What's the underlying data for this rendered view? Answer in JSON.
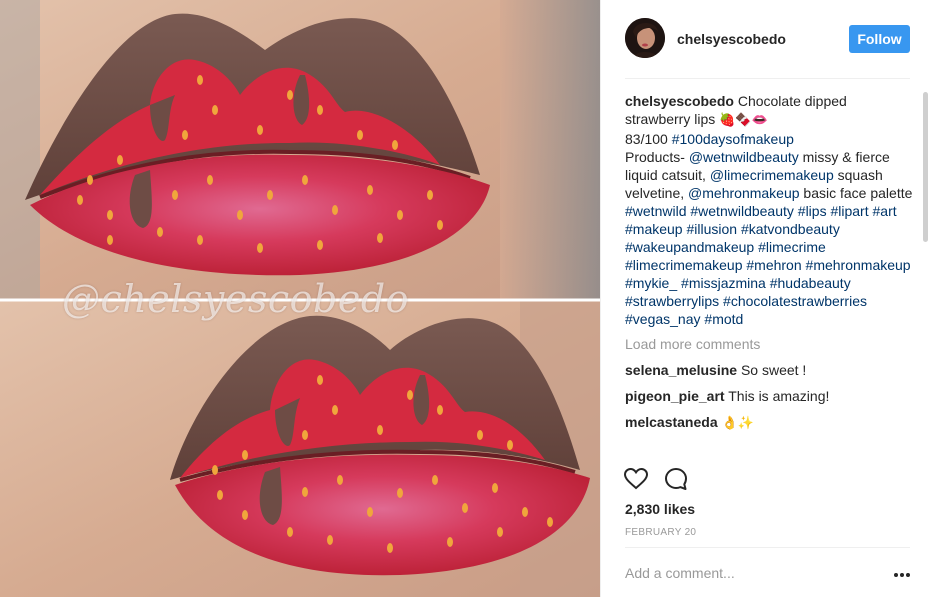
{
  "photo": {
    "watermark": "@chelsyescobedo"
  },
  "header": {
    "username": "chelsyescobedo",
    "follow_label": "Follow"
  },
  "caption": {
    "username": "chelsyescobedo",
    "text1": " Chocolate dipped strawberry lips ",
    "emoji1": "🍓🍫👄",
    "line2_prefix": "83/100 ",
    "hashtag_100days": "#100daysofmakeup",
    "products_prefix": "Products- ",
    "mention1": "@wetnwildbeauty",
    "products_mid1": " missy & fierce liquid catsuit, ",
    "mention2": "@limecrimemakeup",
    "products_mid2": " squash velvetine, ",
    "mention3": "@mehronmakeup",
    "products_end": " basic face palette",
    "hashtags": [
      "#wetnwild",
      "#wetnwildbeauty",
      "#lips",
      "#lipart",
      "#art",
      "#makeup",
      "#illusion",
      "#katvondbeauty",
      "#wakeupandmakeup",
      "#limecrime",
      "#limecrimemakeup",
      "#mehron",
      "#mehronmakeup",
      "#mykie_",
      "#missjazmina",
      "#hudabeauty",
      "#strawberrylips",
      "#chocolatestrawberries",
      "#vegas_nay",
      "#motd"
    ]
  },
  "load_more": "Load more comments",
  "comments": [
    {
      "username": "selena_melusine",
      "text": " So sweet !"
    },
    {
      "username": "pigeon_pie_art",
      "text": " This is amazing!"
    },
    {
      "username": "melcastaneda",
      "text": " 👌✨"
    }
  ],
  "actions": {
    "like_icon": "heart-outline-icon",
    "comment_icon": "speech-bubble-icon"
  },
  "likes": "2,830 likes",
  "date": "FEBRUARY 20",
  "comment_box": {
    "placeholder": "Add a comment...",
    "more_icon": "ellipsis-icon"
  },
  "colors": {
    "follow_blue": "#3897f0",
    "link_navy": "#003569",
    "muted_gray": "#999999",
    "text_dark": "#262626",
    "lip_red": "#d8283e",
    "chocolate": "#6b4a42",
    "seed_orange": "#f0a63c"
  }
}
